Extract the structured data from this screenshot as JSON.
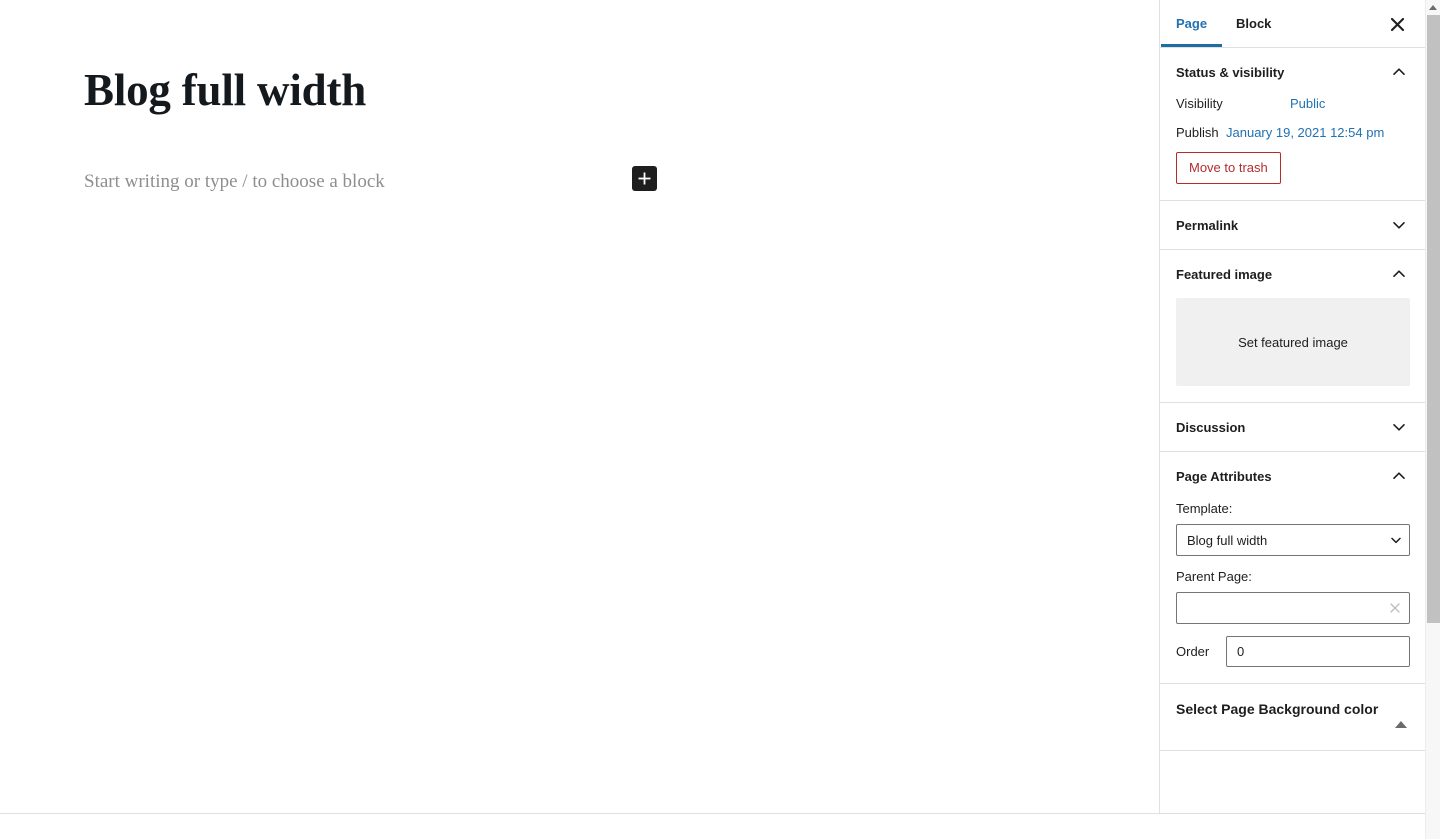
{
  "editor": {
    "post_title": "Blog full width",
    "block_placeholder": "Start writing or type / to choose a block",
    "inserter_label": "+",
    "inserter_icon": "plus-icon"
  },
  "sidebar": {
    "tabs": [
      {
        "label": "Page",
        "active": true
      },
      {
        "label": "Block",
        "active": false
      }
    ],
    "close_icon": "close-icon",
    "panels": {
      "status_visibility": {
        "title": "Status & visibility",
        "expanded": true,
        "chevron_icon": "chevron-up-icon",
        "visibility_label": "Visibility",
        "visibility_value": "Public",
        "publish_label": "Publish",
        "publish_value": "January 19, 2021 12:54 pm",
        "trash_label": "Move to trash"
      },
      "permalink": {
        "title": "Permalink",
        "expanded": false,
        "chevron_icon": "chevron-down-icon"
      },
      "featured_image": {
        "title": "Featured image",
        "expanded": true,
        "chevron_icon": "chevron-up-icon",
        "set_image_label": "Set featured image"
      },
      "discussion": {
        "title": "Discussion",
        "expanded": false,
        "chevron_icon": "chevron-down-icon"
      },
      "page_attributes": {
        "title": "Page Attributes",
        "expanded": true,
        "chevron_icon": "chevron-up-icon",
        "template_label": "Template:",
        "template_value": "Blog full width",
        "template_arrow_icon": "chevron-down-icon",
        "parent_label": "Parent Page:",
        "parent_value": "",
        "parent_placeholder": "",
        "parent_clear_icon": "clear-x-icon",
        "order_label": "Order",
        "order_value": "0"
      },
      "background_color": {
        "title": "Select Page Background color",
        "expanded": true,
        "toggle_icon": "triangle-up-icon"
      }
    }
  },
  "scrollbar": {
    "up_arrow_icon": "triangle-up-icon",
    "thumb_name": "scroll-thumb"
  },
  "colors": {
    "accent_blue": "#2271b1",
    "tab_underline": "#1d6ea4",
    "danger_red": "#b32d2e",
    "text": "#1e1e1e",
    "muted": "#8e8e8e",
    "border": "#e0e0e0",
    "placeholder_bg": "#f0f0f0",
    "inserter_bg": "#1e1e1e",
    "scroll_thumb": "#c1c1c1"
  }
}
